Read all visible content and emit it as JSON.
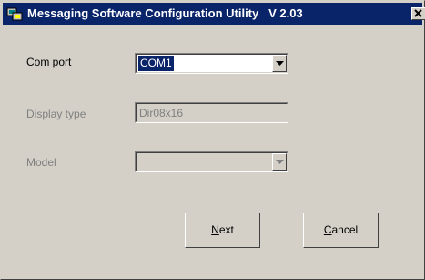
{
  "window": {
    "title": "Messaging Software Configuration Utility   V 2.03",
    "close_glyph": "✕"
  },
  "fields": {
    "com_port": {
      "label": "Com port",
      "value": "COM1"
    },
    "display_type": {
      "label": "Display type",
      "value": "Dir08x16"
    },
    "model": {
      "label": "Model",
      "value": ""
    }
  },
  "buttons": {
    "next": {
      "accel": "N",
      "rest": "ext"
    },
    "cancel": {
      "accel": "C",
      "rest": "ancel"
    }
  },
  "colors": {
    "titlebar": "#0a246a",
    "face": "#d4d0c8",
    "disabled_text": "#808080"
  }
}
